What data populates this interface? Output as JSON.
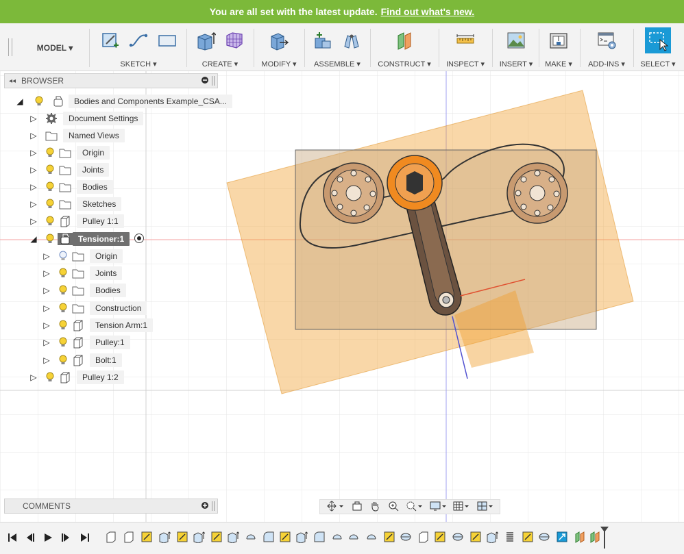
{
  "banner": {
    "message": "You are all set with the latest update.",
    "link": "Find out what's new."
  },
  "toolbar": {
    "workspace": "MODEL ▾",
    "groups": [
      {
        "label": "SKETCH ▾"
      },
      {
        "label": "CREATE ▾"
      },
      {
        "label": "MODIFY ▾"
      },
      {
        "label": "ASSEMBLE ▾"
      },
      {
        "label": "CONSTRUCT ▾"
      },
      {
        "label": "INSPECT ▾"
      },
      {
        "label": "INSERT ▾"
      },
      {
        "label": "MAKE ▾"
      },
      {
        "label": "ADD-INS ▾"
      },
      {
        "label": "SELECT ▾"
      }
    ]
  },
  "browser": {
    "title": "BROWSER",
    "nodes": [
      {
        "label": "Bodies and Components Example_CSA..."
      },
      {
        "label": "Document Settings"
      },
      {
        "label": "Named Views"
      },
      {
        "label": "Origin"
      },
      {
        "label": "Joints"
      },
      {
        "label": "Bodies"
      },
      {
        "label": "Sketches"
      },
      {
        "label": "Pulley 1:1"
      },
      {
        "label": "Tensioner:1"
      },
      {
        "label": "Origin"
      },
      {
        "label": "Joints"
      },
      {
        "label": "Bodies"
      },
      {
        "label": "Construction"
      },
      {
        "label": "Tension Arm:1"
      },
      {
        "label": "Pulley:1"
      },
      {
        "label": "Bolt:1"
      },
      {
        "label": "Pulley 1:2"
      }
    ]
  },
  "comments": {
    "title": "COMMENTS"
  },
  "colors": {
    "banner": "#7cb93a",
    "accent": "#f0a030",
    "select": "#1a9ad6",
    "axis_x": "#e05050",
    "axis_y": "#6060e0"
  }
}
